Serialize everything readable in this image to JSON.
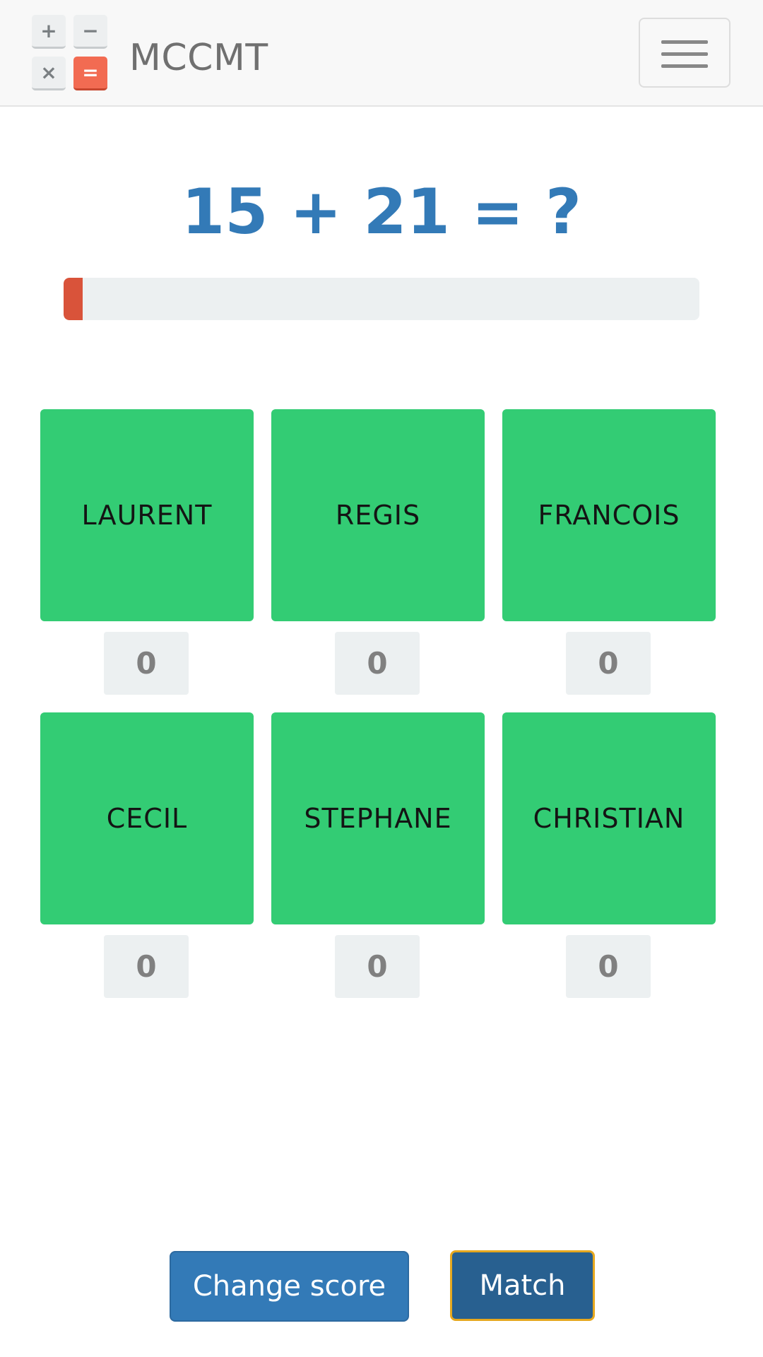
{
  "header": {
    "logo_keys": [
      "+",
      "−",
      "×",
      "="
    ],
    "brand": "MCCMT"
  },
  "question": "15 + 21 = ?",
  "timer": {
    "progress_fraction": 0.03,
    "fill_color": "#d9533a"
  },
  "players": [
    {
      "name": "LAURENT",
      "score": "0"
    },
    {
      "name": "REGIS",
      "score": "0"
    },
    {
      "name": "FRANCOIS",
      "score": "0"
    },
    {
      "name": "CECIL",
      "score": "0"
    },
    {
      "name": "STEPHANE",
      "score": "0"
    },
    {
      "name": "CHRISTIAN",
      "score": "0"
    }
  ],
  "buttons": {
    "change_score": "Change score",
    "match": "Match"
  },
  "colors": {
    "accent": "#337ab7",
    "player_card": "#33cc74",
    "match_outline": "#e6a81f"
  }
}
